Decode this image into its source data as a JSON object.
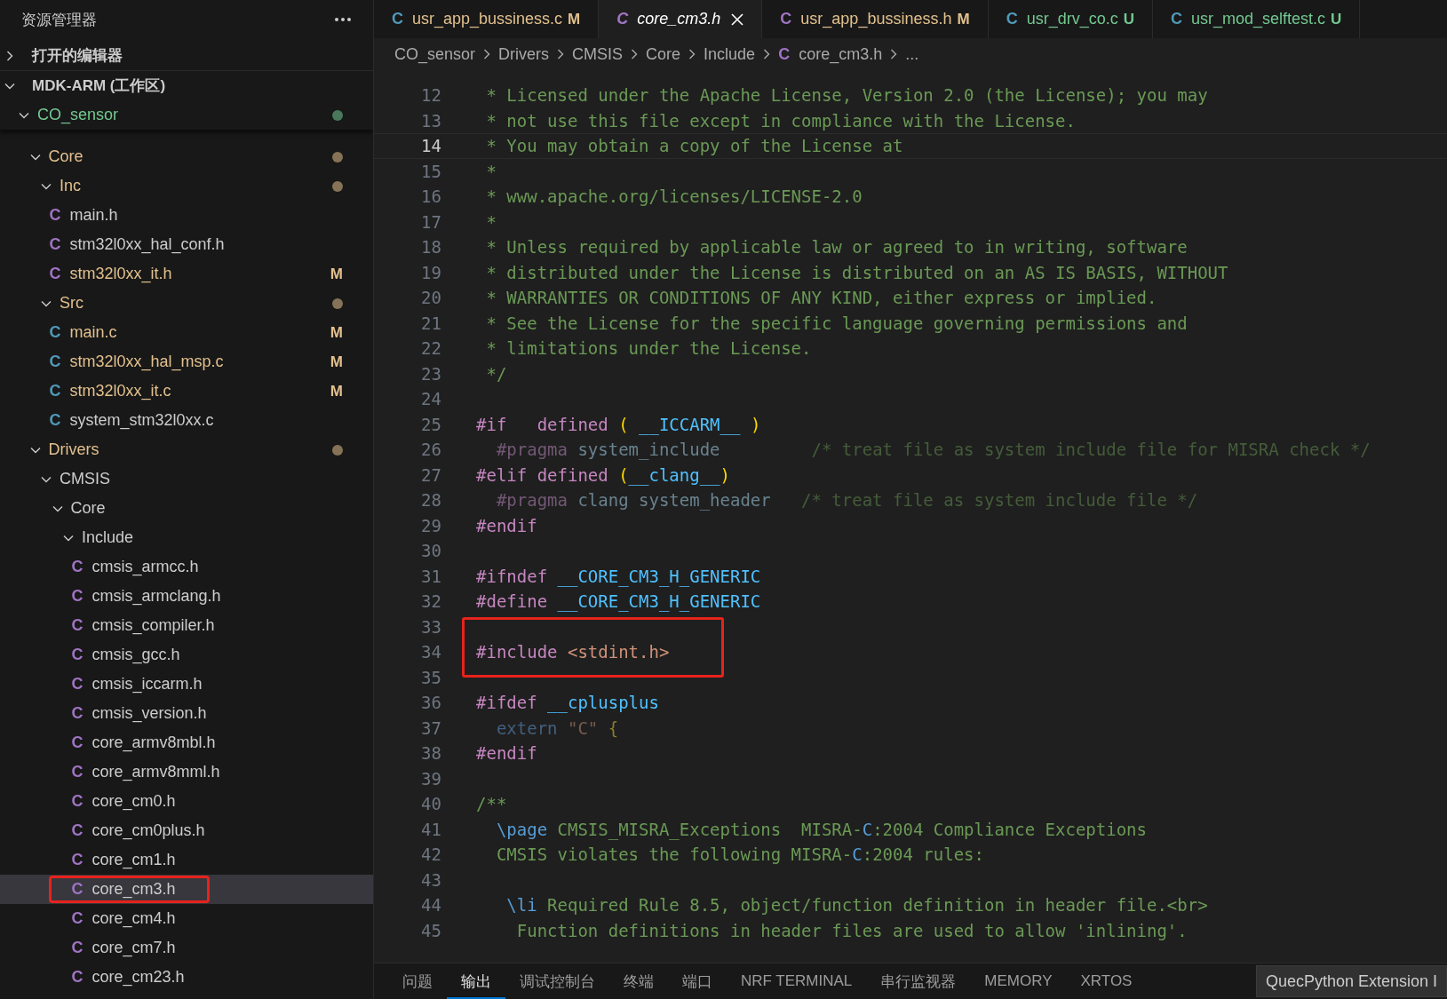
{
  "sidebar": {
    "title": "资源管理器",
    "sections": [
      {
        "label": "打开的编辑器",
        "expanded": false
      },
      {
        "label": "MDK-ARM (工作区)",
        "expanded": true
      }
    ],
    "tree": [
      {
        "label": "CO_sensor",
        "kind": "folder",
        "color": "#73c991",
        "dot": true,
        "expanded": true,
        "children": [
          {
            "label": "Core",
            "kind": "folder",
            "color": "#e2c08d",
            "dot": true,
            "expanded": true,
            "children": [
              {
                "label": "Inc",
                "kind": "folder",
                "color": "#e2c08d",
                "dot": true,
                "expanded": true,
                "children": [
                  {
                    "label": "main.h",
                    "kind": "header",
                    "icon": "C",
                    "color": "#cccccc",
                    "selected": false,
                    "boxed": false
                  },
                  {
                    "label": "stm32l0xx_hal_conf.h",
                    "kind": "header",
                    "icon": "C",
                    "color": "#cccccc",
                    "selected": false,
                    "boxed": false
                  },
                  {
                    "label": "stm32l0xx_it.h",
                    "kind": "header",
                    "icon": "C",
                    "color": "#e2c08d",
                    "badge": "M",
                    "selected": false,
                    "boxed": false
                  }
                ]
              },
              {
                "label": "Src",
                "kind": "folder",
                "color": "#e2c08d",
                "dot": true,
                "expanded": true,
                "children": [
                  {
                    "label": "main.c",
                    "kind": "source",
                    "icon": "C",
                    "color": "#e2c08d",
                    "badge": "M",
                    "selected": false,
                    "boxed": false
                  },
                  {
                    "label": "stm32l0xx_hal_msp.c",
                    "kind": "source",
                    "icon": "C",
                    "color": "#e2c08d",
                    "badge": "M",
                    "selected": false,
                    "boxed": false
                  },
                  {
                    "label": "stm32l0xx_it.c",
                    "kind": "source",
                    "icon": "C",
                    "color": "#e2c08d",
                    "badge": "M",
                    "selected": false,
                    "boxed": false
                  },
                  {
                    "label": "system_stm32l0xx.c",
                    "kind": "source",
                    "icon": "C",
                    "color": "#cccccc",
                    "selected": false,
                    "boxed": false
                  }
                ]
              }
            ]
          },
          {
            "label": "Drivers",
            "kind": "folder",
            "color": "#e2c08d",
            "dot": true,
            "expanded": true,
            "children": [
              {
                "label": "CMSIS",
                "kind": "folder",
                "color": "#cccccc",
                "dot": false,
                "expanded": true,
                "children": [
                  {
                    "label": "Core",
                    "kind": "folder",
                    "color": "#cccccc",
                    "dot": false,
                    "expanded": true,
                    "children": [
                      {
                        "label": "Include",
                        "kind": "folder",
                        "color": "#cccccc",
                        "dot": false,
                        "expanded": true,
                        "children": [
                          {
                            "label": "cmsis_armcc.h",
                            "kind": "header",
                            "icon": "C",
                            "color": "#cccccc",
                            "selected": false,
                            "boxed": false
                          },
                          {
                            "label": "cmsis_armclang.h",
                            "kind": "header",
                            "icon": "C",
                            "color": "#cccccc",
                            "selected": false,
                            "boxed": false
                          },
                          {
                            "label": "cmsis_compiler.h",
                            "kind": "header",
                            "icon": "C",
                            "color": "#cccccc",
                            "selected": false,
                            "boxed": false
                          },
                          {
                            "label": "cmsis_gcc.h",
                            "kind": "header",
                            "icon": "C",
                            "color": "#cccccc",
                            "selected": false,
                            "boxed": false
                          },
                          {
                            "label": "cmsis_iccarm.h",
                            "kind": "header",
                            "icon": "C",
                            "color": "#cccccc",
                            "selected": false,
                            "boxed": false
                          },
                          {
                            "label": "cmsis_version.h",
                            "kind": "header",
                            "icon": "C",
                            "color": "#cccccc",
                            "selected": false,
                            "boxed": false
                          },
                          {
                            "label": "core_armv8mbl.h",
                            "kind": "header",
                            "icon": "C",
                            "color": "#cccccc",
                            "selected": false,
                            "boxed": false
                          },
                          {
                            "label": "core_armv8mml.h",
                            "kind": "header",
                            "icon": "C",
                            "color": "#cccccc",
                            "selected": false,
                            "boxed": false
                          },
                          {
                            "label": "core_cm0.h",
                            "kind": "header",
                            "icon": "C",
                            "color": "#cccccc",
                            "selected": false,
                            "boxed": false
                          },
                          {
                            "label": "core_cm0plus.h",
                            "kind": "header",
                            "icon": "C",
                            "color": "#cccccc",
                            "selected": false,
                            "boxed": false
                          },
                          {
                            "label": "core_cm1.h",
                            "kind": "header",
                            "icon": "C",
                            "color": "#cccccc",
                            "selected": false,
                            "boxed": false
                          },
                          {
                            "label": "core_cm3.h",
                            "kind": "header",
                            "icon": "C",
                            "color": "#cccccc",
                            "selected": true,
                            "boxed": true
                          },
                          {
                            "label": "core_cm4.h",
                            "kind": "header",
                            "icon": "C",
                            "color": "#cccccc",
                            "selected": false,
                            "boxed": false
                          },
                          {
                            "label": "core_cm7.h",
                            "kind": "header",
                            "icon": "C",
                            "color": "#cccccc",
                            "selected": false,
                            "boxed": false
                          },
                          {
                            "label": "core_cm23.h",
                            "kind": "header",
                            "icon": "C",
                            "color": "#cccccc",
                            "selected": false,
                            "boxed": false
                          }
                        ]
                      }
                    ]
                  }
                ]
              }
            ]
          }
        ]
      }
    ]
  },
  "tabs": [
    {
      "label": "usr_app_bussiness.c",
      "icon": "C",
      "kind": "source",
      "color": "#e2c08d",
      "badge": "M",
      "selected": false
    },
    {
      "label": "core_cm3.h",
      "icon": "C",
      "kind": "header",
      "color": "#ffffff",
      "selected": true
    },
    {
      "label": "usr_app_bussiness.h",
      "icon": "C",
      "kind": "header",
      "color": "#e2c08d",
      "badge": "M",
      "selected": false
    },
    {
      "label": "usr_drv_co.c",
      "icon": "C",
      "kind": "source",
      "color": "#73c991",
      "badge": "U",
      "selected": false
    },
    {
      "label": "usr_mod_selftest.c",
      "icon": "C",
      "kind": "source",
      "color": "#73c991",
      "badge": "U",
      "selected": false
    }
  ],
  "breadcrumb": [
    {
      "label": "CO_sensor"
    },
    {
      "label": "Drivers"
    },
    {
      "label": "CMSIS"
    },
    {
      "label": "Core"
    },
    {
      "label": "Include"
    },
    {
      "label": "core_cm3.h",
      "icon": "C"
    },
    {
      "label": "..."
    }
  ],
  "editor": {
    "lines": [
      {
        "n": "12",
        "current": false,
        "inactive": false,
        "boxed": false,
        "segs": [
          {
            "kind": "comment",
            "t": " * Licensed under the Apache License, Version 2.0 (the License); you may"
          }
        ]
      },
      {
        "n": "13",
        "current": false,
        "inactive": false,
        "boxed": false,
        "segs": [
          {
            "kind": "comment",
            "t": " * not use this file except in compliance with the License."
          }
        ]
      },
      {
        "n": "14",
        "current": true,
        "inactive": false,
        "boxed": false,
        "segs": [
          {
            "kind": "comment",
            "t": " * You may obtain a copy of the License at"
          }
        ]
      },
      {
        "n": "15",
        "current": false,
        "inactive": false,
        "boxed": false,
        "segs": [
          {
            "kind": "comment",
            "t": " *"
          }
        ]
      },
      {
        "n": "16",
        "current": false,
        "inactive": false,
        "boxed": false,
        "segs": [
          {
            "kind": "comment",
            "t": " * www.apache.org/licenses/LICENSE-2.0"
          }
        ]
      },
      {
        "n": "17",
        "current": false,
        "inactive": false,
        "boxed": false,
        "segs": [
          {
            "kind": "comment",
            "t": " *"
          }
        ]
      },
      {
        "n": "18",
        "current": false,
        "inactive": false,
        "boxed": false,
        "segs": [
          {
            "kind": "comment",
            "t": " * Unless required by applicable law or agreed to in writing, software"
          }
        ]
      },
      {
        "n": "19",
        "current": false,
        "inactive": false,
        "boxed": false,
        "segs": [
          {
            "kind": "comment",
            "t": " * distributed under the License is distributed on an AS IS BASIS, WITHOUT"
          }
        ]
      },
      {
        "n": "20",
        "current": false,
        "inactive": false,
        "boxed": false,
        "segs": [
          {
            "kind": "comment",
            "t": " * WARRANTIES OR CONDITIONS OF ANY KIND, either express or implied."
          }
        ]
      },
      {
        "n": "21",
        "current": false,
        "inactive": false,
        "boxed": false,
        "segs": [
          {
            "kind": "comment",
            "t": " * See the License for the specific language governing permissions and"
          }
        ]
      },
      {
        "n": "22",
        "current": false,
        "inactive": false,
        "boxed": false,
        "segs": [
          {
            "kind": "comment",
            "t": " * limitations under the License."
          }
        ]
      },
      {
        "n": "23",
        "current": false,
        "inactive": false,
        "boxed": false,
        "segs": [
          {
            "kind": "comment",
            "t": " */"
          }
        ]
      },
      {
        "n": "24",
        "current": false
      },
      {
        "n": "25",
        "current": false,
        "inactive": false,
        "boxed": false,
        "segs": [
          {
            "kind": "directive",
            "t": "#if   defined "
          },
          {
            "kind": "bracket",
            "t": "( "
          },
          {
            "kind": "macro",
            "t": "__ICCARM__"
          },
          {
            "kind": "bracket",
            "t": " )"
          }
        ]
      },
      {
        "n": "26",
        "current": false,
        "inactive": true,
        "boxed": false,
        "segs": [
          {
            "kind": "directive",
            "t": "  #pragma"
          },
          {
            "kind": "ident",
            "t": " system_include"
          },
          {
            "kind": "comment",
            "t": "         /* treat file as system include file for MISRA check */"
          }
        ]
      },
      {
        "n": "27",
        "current": false,
        "inactive": false,
        "boxed": false,
        "segs": [
          {
            "kind": "directive",
            "t": "#elif defined "
          },
          {
            "kind": "bracket",
            "t": "("
          },
          {
            "kind": "macro",
            "t": "__clang__"
          },
          {
            "kind": "bracket",
            "t": ")"
          }
        ]
      },
      {
        "n": "28",
        "current": false,
        "inactive": true,
        "boxed": false,
        "segs": [
          {
            "kind": "directive",
            "t": "  #pragma"
          },
          {
            "kind": "ident",
            "t": " clang system_header"
          },
          {
            "kind": "comment",
            "t": "   /* treat file as system include file */"
          }
        ]
      },
      {
        "n": "29",
        "current": false,
        "inactive": false,
        "boxed": false,
        "segs": [
          {
            "kind": "directive",
            "t": "#endif"
          }
        ]
      },
      {
        "n": "30",
        "current": false
      },
      {
        "n": "31",
        "current": false,
        "inactive": false,
        "boxed": false,
        "segs": [
          {
            "kind": "directive",
            "t": "#ifndef "
          },
          {
            "kind": "macro",
            "t": "__CORE_CM3_H_GENERIC"
          }
        ]
      },
      {
        "n": "32",
        "current": false,
        "inactive": false,
        "boxed": false,
        "segs": [
          {
            "kind": "directive",
            "t": "#define "
          },
          {
            "kind": "macro",
            "t": "__CORE_CM3_H_GENERIC"
          }
        ]
      },
      {
        "n": "33",
        "current": false
      },
      {
        "n": "34",
        "current": false,
        "inactive": false,
        "boxed": true,
        "segs": [
          {
            "kind": "directive",
            "t": "#include "
          },
          {
            "kind": "string",
            "t": "<stdint.h>"
          }
        ]
      },
      {
        "n": "35",
        "current": false
      },
      {
        "n": "36",
        "current": false,
        "inactive": false,
        "boxed": false,
        "segs": [
          {
            "kind": "directive",
            "t": "#ifdef "
          },
          {
            "kind": "macro",
            "t": "__cplusplus"
          }
        ]
      },
      {
        "n": "37",
        "current": false,
        "inactive": true,
        "boxed": false,
        "segs": [
          {
            "kind": "keyword",
            "t": "  extern "
          },
          {
            "kind": "string",
            "t": "\"C\""
          },
          {
            "kind": "bracket",
            "t": " {"
          }
        ]
      },
      {
        "n": "38",
        "current": false,
        "inactive": false,
        "boxed": false,
        "segs": [
          {
            "kind": "directive",
            "t": "#endif"
          }
        ]
      },
      {
        "n": "39",
        "current": false
      },
      {
        "n": "40",
        "current": false,
        "inactive": false,
        "boxed": false,
        "segs": [
          {
            "kind": "comment",
            "t": "/**"
          }
        ]
      },
      {
        "n": "41",
        "current": false,
        "inactive": false,
        "boxed": false,
        "segs": [
          {
            "kind": "keyword",
            "t": "  \\page"
          },
          {
            "kind": "comment",
            "t": " CMSIS_MISRA_Exceptions  MISRA-"
          },
          {
            "kind": "keyword",
            "t": "C"
          },
          {
            "kind": "comment",
            "t": ":2004 Compliance Exceptions"
          }
        ]
      },
      {
        "n": "42",
        "current": false,
        "inactive": false,
        "boxed": false,
        "segs": [
          {
            "kind": "comment",
            "t": "  CMSIS violates the following MISRA-"
          },
          {
            "kind": "keyword",
            "t": "C"
          },
          {
            "kind": "comment",
            "t": ":2004 rules:"
          }
        ]
      },
      {
        "n": "43",
        "current": false
      },
      {
        "n": "44",
        "current": false,
        "inactive": false,
        "boxed": false,
        "segs": [
          {
            "kind": "keyword",
            "t": "   \\li"
          },
          {
            "kind": "comment",
            "t": " Required Rule 8.5, object/function definition in header file.<br>"
          }
        ]
      },
      {
        "n": "45",
        "current": false,
        "inactive": false,
        "boxed": false,
        "segs": [
          {
            "kind": "comment",
            "t": "    Function definitions in header files are used to allow 'inlining'."
          }
        ]
      }
    ]
  },
  "panel": {
    "tabs": [
      {
        "label": "问题",
        "selected": false
      },
      {
        "label": "输出",
        "selected": true
      },
      {
        "label": "调试控制台",
        "selected": false
      },
      {
        "label": "终端",
        "selected": false
      },
      {
        "label": "端口",
        "selected": false
      },
      {
        "label": "NRF TERMINAL",
        "selected": false
      },
      {
        "label": "串行监视器",
        "selected": false
      },
      {
        "label": "MEMORY",
        "selected": false
      },
      {
        "label": "XRTOS",
        "selected": false
      }
    ],
    "dropdown": "QuecPython Extension I"
  }
}
